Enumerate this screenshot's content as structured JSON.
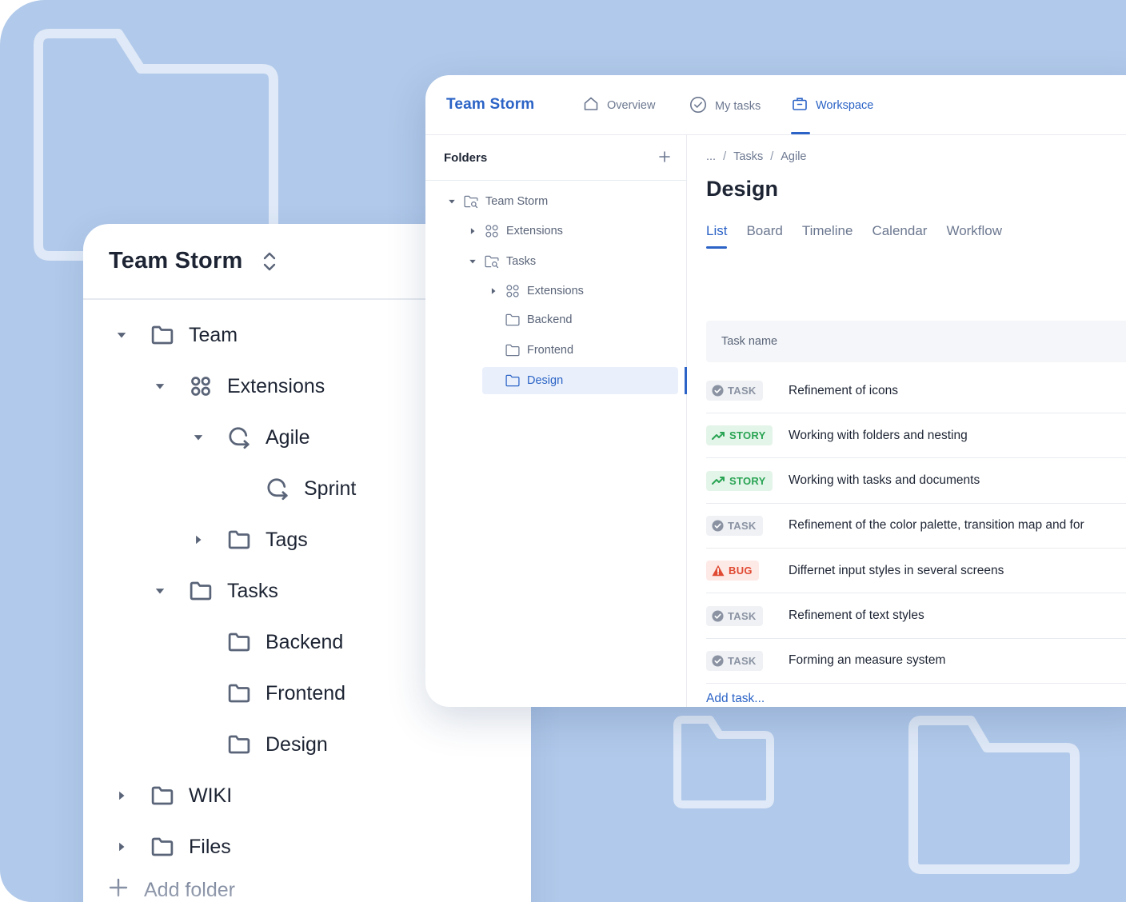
{
  "back_panel": {
    "title": "Team Storm",
    "items": [
      {
        "label": "Team",
        "icon": "folder-icon",
        "caret": "expanded",
        "level": 0
      },
      {
        "label": "Extensions",
        "icon": "extensions-icon",
        "caret": "expanded",
        "level": 1
      },
      {
        "label": "Agile",
        "icon": "agile-icon",
        "caret": "expanded",
        "level": 2
      },
      {
        "label": "Sprint",
        "icon": "sprint-icon",
        "caret": "none",
        "level": 3
      },
      {
        "label": "Tags",
        "icon": "folder-icon",
        "caret": "collapsed",
        "level": 2
      },
      {
        "label": "Tasks",
        "icon": "folder-icon",
        "caret": "expanded",
        "level": 1
      },
      {
        "label": "Backend",
        "icon": "folder-icon",
        "caret": "none",
        "level": 2
      },
      {
        "label": "Frontend",
        "icon": "folder-icon",
        "caret": "none",
        "level": 2
      },
      {
        "label": "Design",
        "icon": "folder-icon",
        "caret": "none",
        "level": 2
      },
      {
        "label": "WIKI",
        "icon": "folder-icon",
        "caret": "collapsed",
        "level": 0
      },
      {
        "label": "Files",
        "icon": "folder-icon",
        "caret": "collapsed",
        "level": 0
      }
    ],
    "add_folder_label": "Add folder"
  },
  "app": {
    "brand": "Team Storm",
    "nav": [
      {
        "label": "Overview",
        "icon": "home-icon",
        "active": false
      },
      {
        "label": "My tasks",
        "icon": "check-circle-icon",
        "active": false
      },
      {
        "label": "Workspace",
        "icon": "briefcase-icon",
        "active": true
      }
    ],
    "sidebar": {
      "title": "Folders",
      "add_icon": "plus-icon",
      "items": [
        {
          "label": "Team Storm",
          "icon": "folder-search-icon",
          "caret": "expanded",
          "level": 0,
          "selected": false
        },
        {
          "label": "Extensions",
          "icon": "extensions-icon",
          "caret": "collapsed",
          "level": 1,
          "selected": false
        },
        {
          "label": "Tasks",
          "icon": "folder-search-icon",
          "caret": "expanded",
          "level": 1,
          "selected": false
        },
        {
          "label": "Extensions",
          "icon": "extensions-icon",
          "caret": "collapsed",
          "level": 2,
          "selected": false
        },
        {
          "label": "Backend",
          "icon": "folder-icon",
          "caret": "none",
          "level": 2,
          "selected": false
        },
        {
          "label": "Frontend",
          "icon": "folder-icon",
          "caret": "none",
          "level": 2,
          "selected": false
        },
        {
          "label": "Design",
          "icon": "folder-icon",
          "caret": "none",
          "level": 2,
          "selected": true
        }
      ]
    },
    "breadcrumb": [
      "...",
      "Tasks",
      "Agile"
    ],
    "page_title": "Design",
    "tabs": [
      {
        "label": "List",
        "active": true
      },
      {
        "label": "Board",
        "active": false
      },
      {
        "label": "Timeline",
        "active": false
      },
      {
        "label": "Calendar",
        "active": false
      },
      {
        "label": "Workflow",
        "active": false
      }
    ],
    "table_header": "Task name",
    "tasks": [
      {
        "type": "TASK",
        "icon": "check-circle-icon",
        "name": "Refinement of icons"
      },
      {
        "type": "STORY",
        "icon": "trend-up-icon",
        "name": "Working with folders and nesting"
      },
      {
        "type": "STORY",
        "icon": "trend-up-icon",
        "name": "Working with tasks and documents"
      },
      {
        "type": "TASK",
        "icon": "check-circle-icon",
        "name": "Refinement of the color palette, transition map and for"
      },
      {
        "type": "BUG",
        "icon": "warning-icon",
        "name": "Differnet input styles in several screens"
      },
      {
        "type": "TASK",
        "icon": "check-circle-icon",
        "name": "Refinement of text styles"
      },
      {
        "type": "TASK",
        "icon": "check-circle-icon",
        "name": "Forming an measure system"
      }
    ],
    "add_task_label": "Add task..."
  },
  "colors": {
    "background": "#b1c9ea",
    "accent": "#2b63c6",
    "story_green": "#29a454",
    "bug_red": "#e04a32",
    "task_gray": "#8b93a3"
  }
}
